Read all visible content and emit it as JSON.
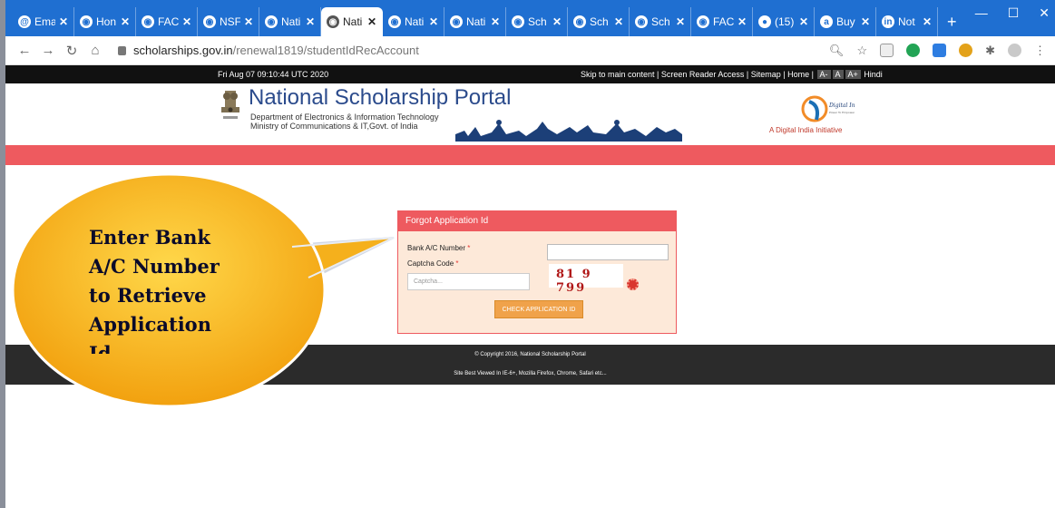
{
  "browser": {
    "tabs": [
      {
        "label": "Ema",
        "icon": "@"
      },
      {
        "label": "Hon",
        "icon": "globe"
      },
      {
        "label": "FAC",
        "icon": "globe"
      },
      {
        "label": "NSF",
        "icon": "globe"
      },
      {
        "label": "Nati",
        "icon": "globe"
      },
      {
        "label": "Nati",
        "icon": "globe",
        "active": true
      },
      {
        "label": "Nati",
        "icon": "globe"
      },
      {
        "label": "Nati",
        "icon": "globe"
      },
      {
        "label": "Sch",
        "icon": "globe"
      },
      {
        "label": "Sch",
        "icon": "globe"
      },
      {
        "label": "Sch",
        "icon": "globe"
      },
      {
        "label": "FAC",
        "icon": "globe"
      },
      {
        "label": "(15)",
        "icon": "whatsapp"
      },
      {
        "label": "Buy",
        "icon": "amazon"
      },
      {
        "label": "Not",
        "icon": "linkedin"
      }
    ],
    "new_tab": "+",
    "url_host": "scholarships.gov.in",
    "url_path": "/renewal1819/studentIdRecAccount",
    "colors": {
      "tabstrip": "#1f6fd1"
    }
  },
  "site": {
    "date": "Fri Aug 07 09:10:44 UTC 2020",
    "top_links": "Skip to main content | Screen Reader Access | Sitemap | Home |",
    "font_buttons": [
      "A-",
      "A",
      "A+"
    ],
    "language": "Hindi",
    "title": "National Scholarship Portal",
    "dept_line1": "Department of Electronics & Information Technology",
    "dept_line2": "Ministry of Communications & IT,Govt. of India",
    "di_label": "A Digital India Initiative",
    "colors": {
      "accent": "#ee5a5f",
      "panel_bg": "#fde9d9",
      "button": "#f0a24a"
    }
  },
  "form": {
    "heading": "Forgot Application Id",
    "account_label": "Bank A/C Number",
    "captcha_label": "Captcha Code",
    "required_mark": "*",
    "captcha_placeholder": "Captcha...",
    "captcha_text": "81 9 799",
    "submit_label": "CHECK APPLICATION ID"
  },
  "footer": {
    "copyright": "© Copyright 2016, National Scholarship Portal",
    "best_viewed": "Site Best Viewed In IE-6+, Mozilla Firefox, Chrome, Safari etc..."
  },
  "callout": {
    "line1": "Enter Bank",
    "line2": "A/C Number",
    "line3": "to Retrieve",
    "line4": "Application",
    "line5": "Id",
    "color": "#f6b21e"
  }
}
